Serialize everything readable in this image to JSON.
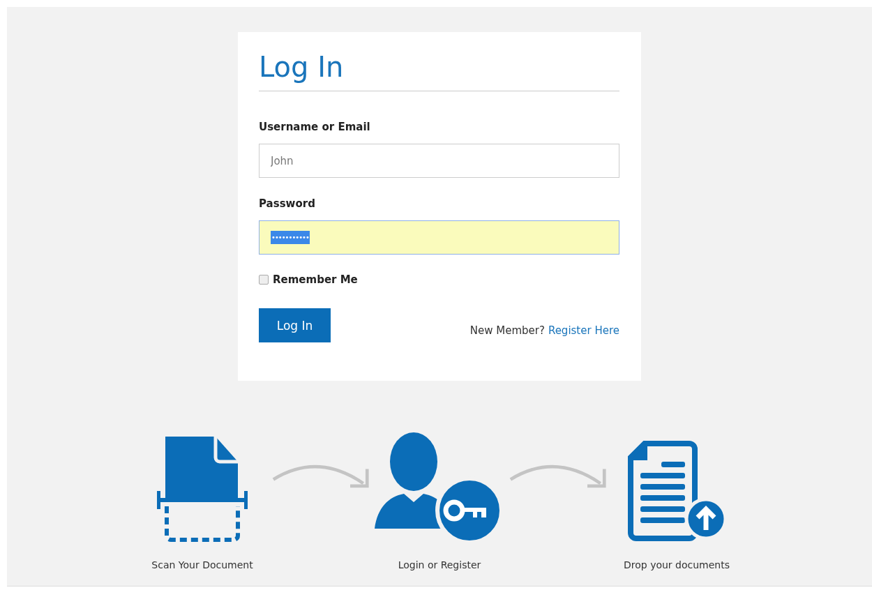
{
  "login_form": {
    "title": "Log In",
    "fields": [
      {
        "label": "Username or Email",
        "kind": "text",
        "placeholder": "John"
      },
      {
        "label": "Password",
        "kind": "password",
        "value": "•••••••••••",
        "autofilled": true,
        "selected": true
      }
    ],
    "remember_me": {
      "label": "Remember Me",
      "checked": false
    },
    "submit_button": "Log In",
    "register_prompt": "New Member?",
    "register_link": "Register Here"
  },
  "steps": [
    {
      "kind": "scan",
      "label": "Scan Your Document"
    },
    {
      "kind": "user-key",
      "label": "Login or Register"
    },
    {
      "kind": "document-upload",
      "label": "Drop your documents"
    }
  ]
}
